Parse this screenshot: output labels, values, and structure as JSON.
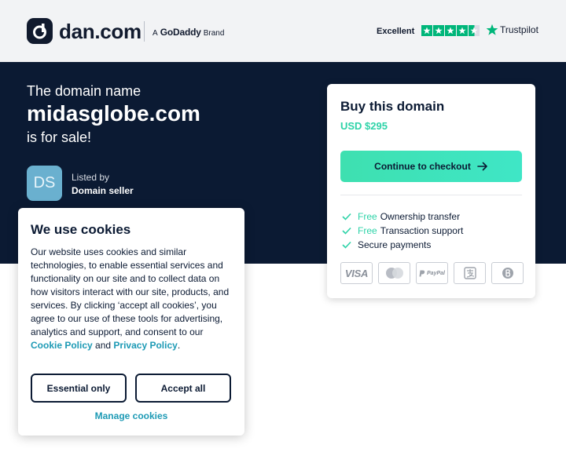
{
  "header": {
    "logo_text": "dan.com",
    "brand_prefix": "A",
    "brand_name": "GoDaddy",
    "brand_suffix": "Brand",
    "trustpilot_rating_label": "Excellent",
    "trustpilot_label": "Trustpilot",
    "trustpilot_stars": 4.5
  },
  "hero": {
    "line1": "The domain name",
    "domain": "midasglobe.com",
    "line3": "is for sale!",
    "avatar_initials": "DS",
    "listed_by_label": "Listed by",
    "seller": "Domain seller"
  },
  "buy_card": {
    "title": "Buy this domain",
    "price": "USD $295",
    "checkout_label": "Continue to checkout",
    "features": [
      {
        "free": "Free",
        "text": "Ownership transfer"
      },
      {
        "free": "Free",
        "text": "Transaction support"
      },
      {
        "free": "",
        "text": "Secure payments"
      }
    ],
    "payment_methods": [
      "visa-icon",
      "mastercard-icon",
      "paypal-icon",
      "alipay-icon",
      "bitcoin-icon"
    ],
    "visa_label": "VISA",
    "paypal_label": "PayPal"
  },
  "cookie": {
    "title": "We use cookies",
    "body_text": "Our website uses cookies and similar technologies, to enable essential services and functionality on our site and to collect data on how visitors interact with our site, products, and services. By clicking ‘accept all cookies’, you agree to our use of these tools for advertising, analytics and support, and consent to our",
    "cookie_policy_label": "Cookie Policy",
    "and_label": "and",
    "privacy_policy_label": "Privacy Policy",
    "period": ".",
    "essential_label": "Essential only",
    "accept_label": "Accept all",
    "manage_label": "Manage cookies"
  },
  "colors": {
    "navy": "#0b1a33",
    "accent_green": "#2ed3a8",
    "link_blue": "#1d9ab5",
    "trustpilot_green": "#00b67a"
  }
}
